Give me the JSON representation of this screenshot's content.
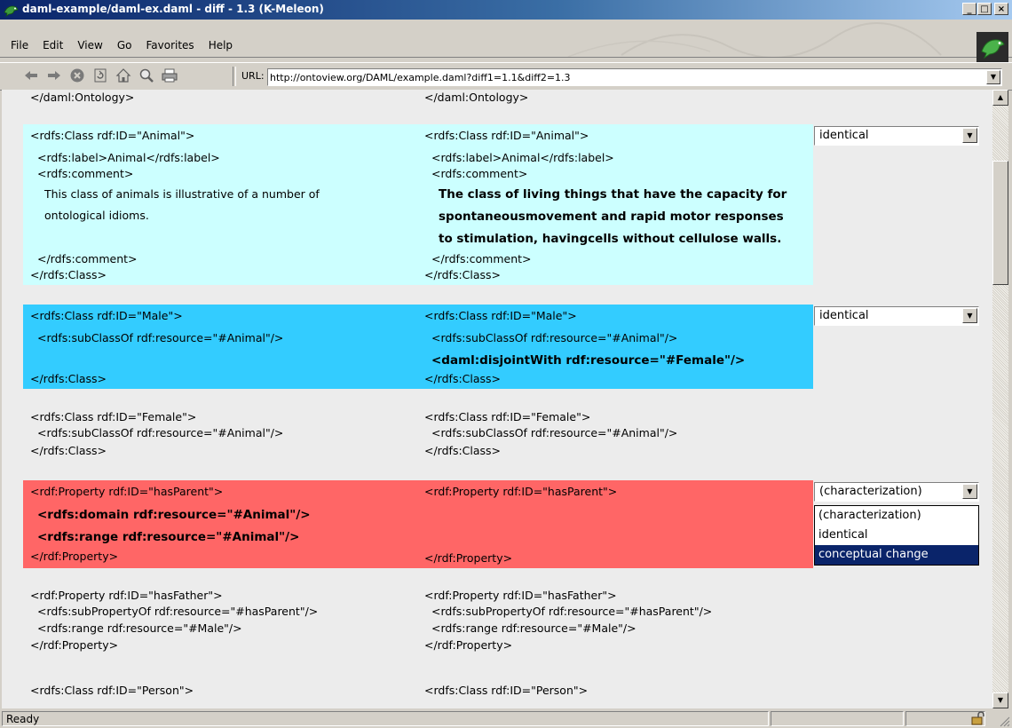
{
  "window": {
    "title": "daml-example/daml-ex.daml - diff - 1.3 (K-Meleon)",
    "min_label": "_",
    "max_label": "□",
    "close_label": "×"
  },
  "menubar": {
    "items": [
      "File",
      "Edit",
      "View",
      "Go",
      "Favorites",
      "Help"
    ]
  },
  "toolbar": {
    "icons": [
      "back-arrow-icon",
      "forward-arrow-icon",
      "stop-icon",
      "reload-icon",
      "home-icon",
      "search-icon",
      "print-icon"
    ],
    "url_label": "URL:",
    "url": "http://ontoview.org/DAML/example.daml?diff1=1.1&diff2=1.3"
  },
  "colors": {
    "animal_block": "#ccffff",
    "male_block": "#33ccff",
    "hasparent_block": "#ff6666",
    "content_bg": "#ececec",
    "selected_option": "#0a246a"
  },
  "diff": {
    "ontology_end": {
      "left": "</daml:Ontology>",
      "right": "</daml:Ontology>"
    },
    "animal": {
      "left": [
        "<rdfs:Class rdf:ID=\"Animal\">",
        "<rdfs:label>Animal</rdfs:label>",
        "<rdfs:comment>",
        "This class of animals is illustrative of a number of",
        "ontological idioms.",
        "</rdfs:comment>",
        "</rdfs:Class>"
      ],
      "right": [
        "<rdfs:Class rdf:ID=\"Animal\">",
        "<rdfs:label>Animal</rdfs:label>",
        "<rdfs:comment>",
        "The class of living things that have the capacity for",
        "spontaneousmovement and rapid motor responses",
        "to stimulation, havingcells without cellulose walls.",
        "</rdfs:comment>",
        "</rdfs:Class>"
      ],
      "select_value": "identical"
    },
    "male": {
      "left": [
        "<rdfs:Class rdf:ID=\"Male\">",
        "<rdfs:subClassOf rdf:resource=\"#Animal\"/>",
        "</rdfs:Class>"
      ],
      "right": [
        "<rdfs:Class rdf:ID=\"Male\">",
        "<rdfs:subClassOf rdf:resource=\"#Animal\"/>",
        "<daml:disjointWith rdf:resource=\"#Female\"/>",
        "</rdfs:Class>"
      ],
      "select_value": "identical"
    },
    "female": {
      "left": [
        "<rdfs:Class rdf:ID=\"Female\">",
        "<rdfs:subClassOf rdf:resource=\"#Animal\"/>",
        "</rdfs:Class>"
      ],
      "right": [
        "<rdfs:Class rdf:ID=\"Female\">",
        "<rdfs:subClassOf rdf:resource=\"#Animal\"/>",
        "</rdfs:Class>"
      ]
    },
    "hasparent": {
      "left": [
        "<rdf:Property rdf:ID=\"hasParent\">",
        "<rdfs:domain rdf:resource=\"#Animal\"/>",
        "<rdfs:range rdf:resource=\"#Animal\"/>",
        "</rdf:Property>"
      ],
      "right": [
        "<rdf:Property rdf:ID=\"hasParent\">",
        "</rdf:Property>"
      ],
      "select_value": "(characterization)",
      "options": [
        "(characterization)",
        "identical",
        "conceptual change"
      ]
    },
    "hasfather": {
      "left": [
        "<rdf:Property rdf:ID=\"hasFather\">",
        "<rdfs:subPropertyOf rdf:resource=\"#hasParent\"/>",
        "<rdfs:range rdf:resource=\"#Male\"/>",
        "</rdf:Property>"
      ],
      "right": [
        "<rdf:Property rdf:ID=\"hasFather\">",
        "<rdfs:subPropertyOf rdf:resource=\"#hasParent\"/>",
        "<rdfs:range rdf:resource=\"#Male\"/>",
        "</rdf:Property>"
      ]
    },
    "person": {
      "left": [
        "<rdfs:Class rdf:ID=\"Person\">"
      ],
      "right": [
        "<rdfs:Class rdf:ID=\"Person\">"
      ]
    }
  },
  "statusbar": {
    "text": "Ready"
  }
}
